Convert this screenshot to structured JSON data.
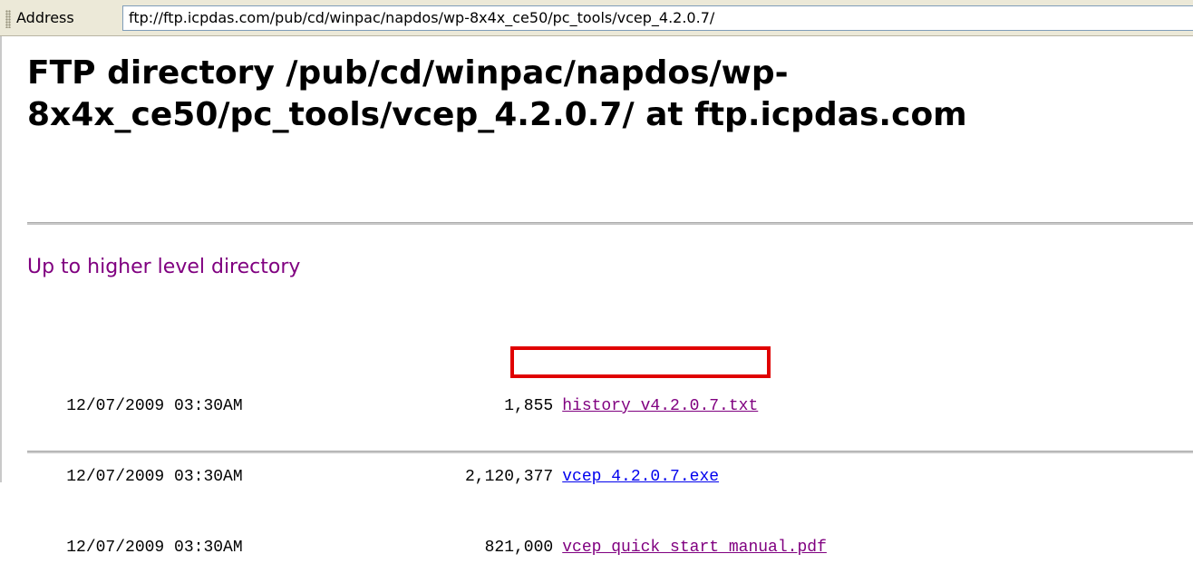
{
  "address_bar": {
    "label": "Address",
    "url": "ftp://ftp.icpdas.com/pub/cd/winpac/napdos/wp-8x4x_ce50/pc_tools/vcep_4.2.0.7/"
  },
  "page": {
    "title": "FTP directory /pub/cd/winpac/napdos/wp-8x4x_ce50/pc_tools/vcep_4.2.0.7/ at ftp.icpdas.com",
    "up_link": "Up to higher level directory"
  },
  "files": [
    {
      "date": "12/07/2009 03:30AM",
      "size": "1,855",
      "name": "history v4.2.0.7.txt"
    },
    {
      "date": "12/07/2009 03:30AM",
      "size": "2,120,377",
      "name": "vcep_4.2.0.7.exe"
    },
    {
      "date": "12/07/2009 03:30AM",
      "size": "821,000",
      "name": "vcep quick start manual.pdf"
    }
  ],
  "colors": {
    "visited_link": "#800080",
    "link": "#0000ee",
    "highlight": "#e00000"
  }
}
